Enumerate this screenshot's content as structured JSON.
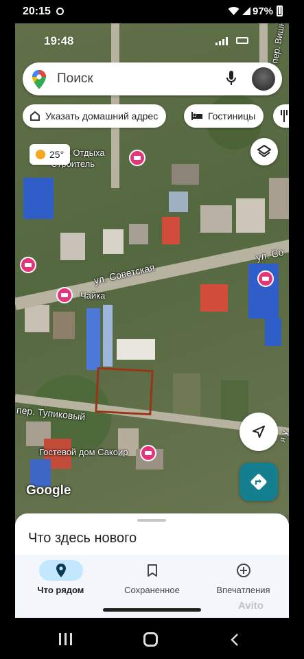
{
  "device": {
    "time": "20:15",
    "battery": "97%"
  },
  "app": {
    "time": "19:48",
    "search": {
      "placeholder": "Поиск"
    },
    "chips": [
      {
        "label": "Указать домашний адрес",
        "icon": "home-icon"
      },
      {
        "label": "Гостиницы",
        "icon": "hotel-icon"
      },
      {
        "label": "",
        "icon": "restaurant-icon"
      }
    ],
    "weather": {
      "temperature": "25°",
      "icon": "sun-icon"
    },
    "map": {
      "streets": [
        "ул. Советская",
        "ул. Со",
        "пер. Тупиковый",
        "пер. Вишн",
        "я у"
      ],
      "places": [
        {
          "name": "База Отдыха\nСтроитель"
        },
        {
          "name": "Чайка"
        },
        {
          "name": "Гостевой дом Сакоир"
        }
      ],
      "logo": "Google"
    },
    "sheet": {
      "title": "Что здесь нового"
    },
    "nav": [
      {
        "label": "Что рядом",
        "icon": "location-pin-icon",
        "active": true
      },
      {
        "label": "Сохраненное",
        "icon": "bookmark-icon",
        "active": false
      },
      {
        "label": "Впечатления",
        "icon": "add-circle-icon",
        "active": false
      }
    ],
    "watermark": "Avito",
    "accent": "#137f8f",
    "poi_color": "#e6347a"
  }
}
